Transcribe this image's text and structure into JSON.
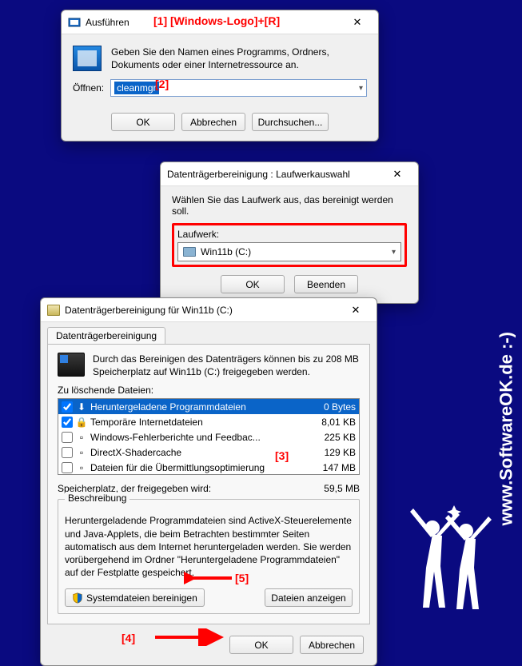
{
  "watermark": "www.SoftwareOK.de :-)",
  "annotations": {
    "a1": "[1]  [Windows-Logo]+[R]",
    "a2": "[2]",
    "a3": "[3]",
    "a4": "[4]",
    "a5": "[5]"
  },
  "run_dialog": {
    "title": "Ausführen",
    "description": "Geben Sie den Namen eines Programms, Ordners, Dokuments oder einer Internetressource an.",
    "open_label": "Öffnen:",
    "command": "cleanmgr",
    "ok": "OK",
    "cancel": "Abbrechen",
    "browse": "Durchsuchen..."
  },
  "drive_dialog": {
    "title": "Datenträgerbereinigung : Laufwerkauswahl",
    "instruction": "Wählen Sie das Laufwerk aus, das bereinigt werden soll.",
    "fieldset_label": "Laufwerk:",
    "selected_drive": "Win11b (C:)",
    "ok": "OK",
    "exit": "Beenden"
  },
  "cleanup_dialog": {
    "title": "Datenträgerbereinigung für Win11b (C:)",
    "tab_label": "Datenträgerbereinigung",
    "summary": "Durch das Bereinigen des Datenträgers können bis zu 208 MB Speicherplatz auf Win11b (C:) freigegeben werden.",
    "files_label": "Zu löschende Dateien:",
    "files": [
      {
        "checked": true,
        "icon": "download",
        "name": "Heruntergeladene Programmdateien",
        "size": "0 Bytes",
        "selected": true
      },
      {
        "checked": true,
        "icon": "lock",
        "name": "Temporäre Internetdateien",
        "size": "8,01 KB",
        "selected": false
      },
      {
        "checked": false,
        "icon": "generic",
        "name": "Windows-Fehlerberichte und Feedbac...",
        "size": "225 KB",
        "selected": false
      },
      {
        "checked": false,
        "icon": "generic",
        "name": "DirectX-Shadercache",
        "size": "129 KB",
        "selected": false
      },
      {
        "checked": false,
        "icon": "generic",
        "name": "Dateien für die Übermittlungsoptimierung",
        "size": "147 MB",
        "selected": false
      }
    ],
    "space_label": "Speicherplatz, der freigegeben wird:",
    "space_value": "59,5 MB",
    "description_label": "Beschreibung",
    "description_text": "Heruntergeladende Programmdateien sind ActiveX-Steuerelemente und Java-Applets, die beim Betrachten bestimmter Seiten automatisch aus dem Internet heruntergeladen werden. Sie werden vorübergehend im Ordner \"Heruntergeladene Programmdateien\" auf der Festplatte gespeichert.",
    "clean_system": "Systemdateien bereinigen",
    "view_files": "Dateien anzeigen",
    "ok": "OK",
    "cancel": "Abbrechen"
  }
}
